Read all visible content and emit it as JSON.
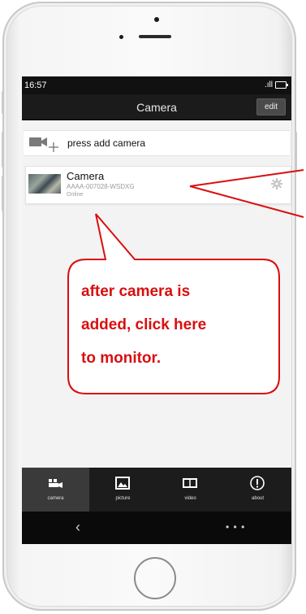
{
  "status_bar": {
    "time": "16:57",
    "signal": ".ıll"
  },
  "title_bar": {
    "title": "Camera",
    "edit_label": "edit"
  },
  "add_row": {
    "label": "press add camera"
  },
  "camera": {
    "name": "Camera",
    "id": "AAAA-007028-WSDXG",
    "status": "Online"
  },
  "tabs": [
    {
      "label": "camera",
      "icon": "camera-tab-icon"
    },
    {
      "label": "picture",
      "icon": "picture-tab-icon"
    },
    {
      "label": "video",
      "icon": "video-tab-icon"
    },
    {
      "label": "about",
      "icon": "about-tab-icon"
    }
  ],
  "nav": {
    "back": "‹",
    "more": "• • •"
  },
  "annotation": {
    "lines": [
      "after   camera   is",
      "added, click here",
      "to monitor."
    ],
    "color": "#d90f0f"
  }
}
